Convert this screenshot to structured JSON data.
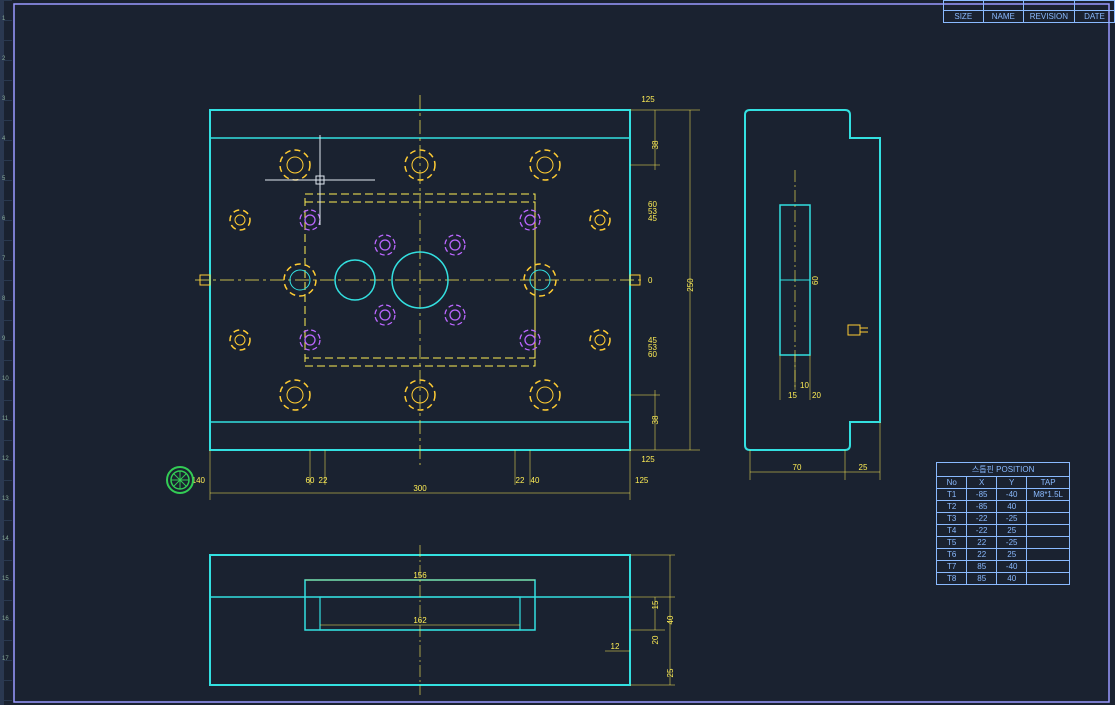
{
  "titleBlock": {
    "rows": [
      [
        "",
        "",
        "",
        ""
      ],
      [
        "SIZE",
        "NAME",
        "REVISION",
        "DATE"
      ]
    ]
  },
  "positionTable": {
    "title": "스톱핀 POSITION",
    "headers": [
      "No",
      "X",
      "Y",
      "TAP"
    ],
    "rows": [
      [
        "T1",
        "-85",
        "-40",
        "M8*1.5L"
      ],
      [
        "T2",
        "-85",
        "40",
        ""
      ],
      [
        "T3",
        "-22",
        "-25",
        ""
      ],
      [
        "T4",
        "-22",
        "25",
        ""
      ],
      [
        "T5",
        "22",
        "-25",
        ""
      ],
      [
        "T6",
        "22",
        "25",
        ""
      ],
      [
        "T7",
        "85",
        "-40",
        ""
      ],
      [
        "T8",
        "85",
        "40",
        ""
      ]
    ]
  },
  "dimensions": {
    "top": [
      "125"
    ],
    "right": [
      "38",
      "60",
      "53",
      "45",
      "0",
      "250",
      "45",
      "53",
      "60",
      "38",
      "125"
    ],
    "side": [
      "10",
      "15",
      "20",
      "70",
      "25"
    ],
    "bottom_main": [
      "140",
      "60",
      "22",
      "300",
      "22",
      "40",
      "125"
    ],
    "section": [
      "156",
      "162",
      "40",
      "15",
      "20",
      "25",
      "12"
    ]
  },
  "colors": {
    "bg": "#1a2230",
    "part_cyan": "#33e0e0",
    "dashed_yellow": "#ffee55",
    "dim_line": "#ffee55",
    "circle_yellow": "#ffcc33",
    "circle_purple": "#bb66ff",
    "centerline": "#ffee55",
    "frame": "#9999ff",
    "ruler": "#5577aa",
    "green_circle": "#33cc55"
  }
}
